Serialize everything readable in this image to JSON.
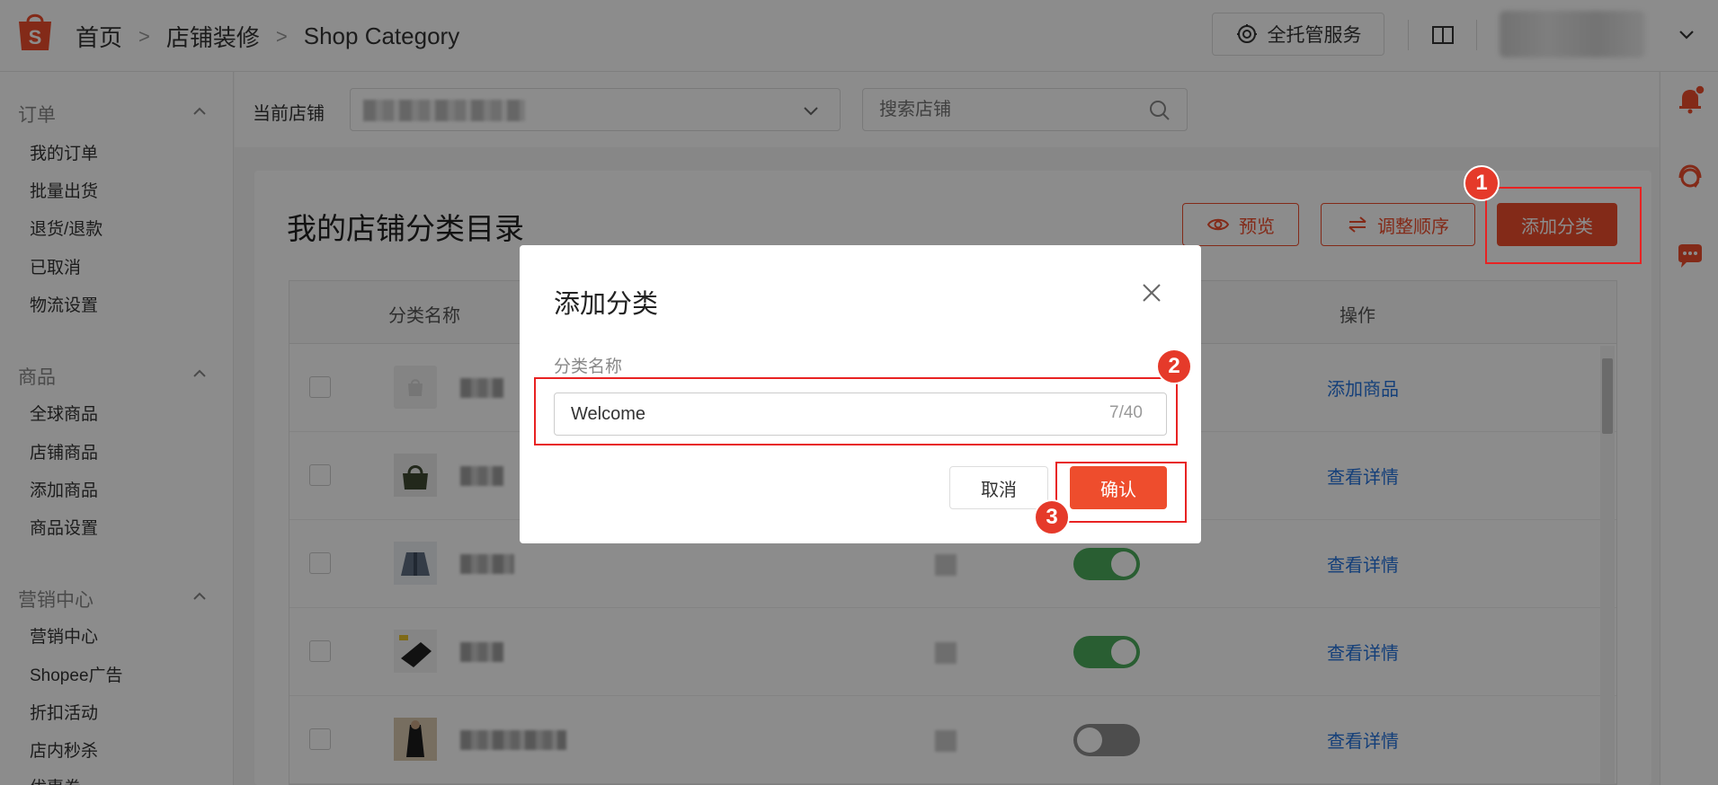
{
  "header": {
    "breadcrumb": [
      "首页",
      "店铺装修",
      "Shop Category"
    ],
    "service_button": "全托管服务"
  },
  "sidebar": {
    "groups": [
      {
        "title": "订单",
        "items": [
          "我的订单",
          "批量出货",
          "退货/退款",
          "已取消",
          "物流设置"
        ]
      },
      {
        "title": "商品",
        "items": [
          "全球商品",
          "店铺商品",
          "添加商品",
          "商品设置"
        ]
      },
      {
        "title": "营销中心",
        "items": [
          "营销中心",
          "Shopee广告",
          "折扣活动",
          "店内秒杀",
          "优惠券"
        ]
      }
    ]
  },
  "storebar": {
    "label": "当前店铺",
    "search_placeholder": "搜索店铺"
  },
  "main": {
    "title": "我的店铺分类目录",
    "preview_button": "预览",
    "reorder_button": "调整顺序",
    "add_category_button": "添加分类",
    "columns": [
      "分类名称",
      "操作"
    ],
    "rows": [
      {
        "action": "添加商品",
        "toggle_on": null
      },
      {
        "action": "查看详情",
        "toggle_on": null
      },
      {
        "action": "查看详情",
        "toggle_on": true
      },
      {
        "action": "查看详情",
        "toggle_on": true
      },
      {
        "action": "查看详情",
        "toggle_on": false
      }
    ]
  },
  "modal": {
    "title": "添加分类",
    "field_label": "分类名称",
    "field_value": "Welcome",
    "char_count": "7/40",
    "cancel_button": "取消",
    "confirm_button": "确认"
  },
  "annotations": [
    "1",
    "2",
    "3"
  ],
  "colors": {
    "brand": "#ee4d2d",
    "link": "#2673dd",
    "toggle_on": "#4cab5c",
    "toggle_off": "#8c8c8c",
    "annotation": "#e82222"
  }
}
